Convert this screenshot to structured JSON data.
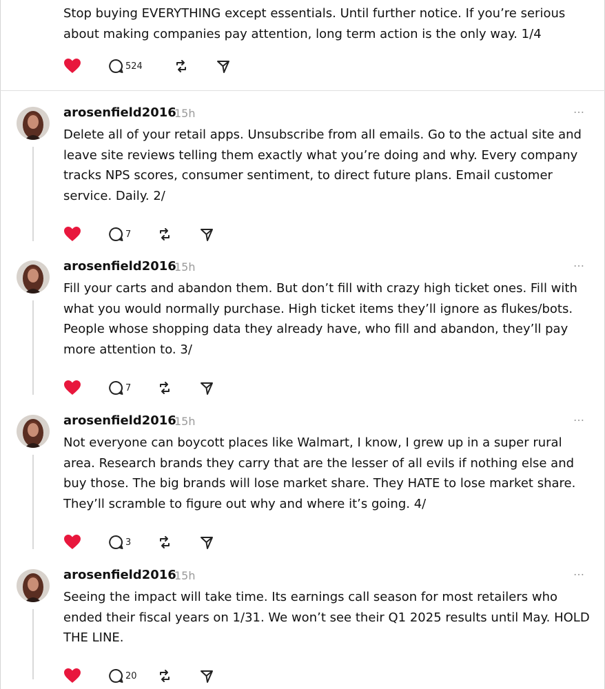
{
  "first_post": {
    "text": "Stop buying EVERYTHING except essentials. Until further notice. If you’re serious about making companies pay attention, long term action is the only way. 1/4",
    "replies": "524"
  },
  "replies": [
    {
      "username": "arosenfield2016",
      "time": "15h",
      "more": "…",
      "text": "Delete all of your retail apps. Unsubscribe from all emails. Go to the actual site and leave site reviews telling them exactly what you’re doing and why. Every company tracks NPS scores, consumer sentiment, to direct future plans. Email customer service. Daily. 2/",
      "replies": "7"
    },
    {
      "username": "arosenfield2016",
      "time": "15h",
      "more": "…",
      "text": "Fill your carts and abandon them. But don’t fill with crazy high ticket ones. Fill with what you would normally purchase. High ticket items they’ll ignore as flukes/bots. People whose shopping data they already have, who fill and abandon, they’ll pay more attention to. 3/",
      "replies": "7"
    },
    {
      "username": "arosenfield2016",
      "time": "15h",
      "more": "…",
      "text": "Not everyone can boycott places like Walmart, I know, I grew up in a super rural area. Research brands they carry that are the lesser of all evils if nothing else and buy those. The big brands will lose market share. They HATE to lose market share. They’ll scramble to figure out why and where it’s going. 4/",
      "replies": "3"
    },
    {
      "username": "arosenfield2016",
      "time": "15h",
      "more": "…",
      "text": "Seeing the impact will take time. Its earnings call season for most retailers who ended their fiscal years on 1/31. We won’t see their Q1 2025 results until May. HOLD THE LINE.",
      "replies": "20"
    }
  ],
  "colors": {
    "heart": "#e8173d",
    "text": "#111111",
    "muted": "#9a9a9a",
    "thread_line": "#d9d9d9"
  },
  "icons": [
    "heart-icon",
    "comment-icon",
    "repost-icon",
    "share-icon",
    "avatar",
    "more-icon"
  ]
}
